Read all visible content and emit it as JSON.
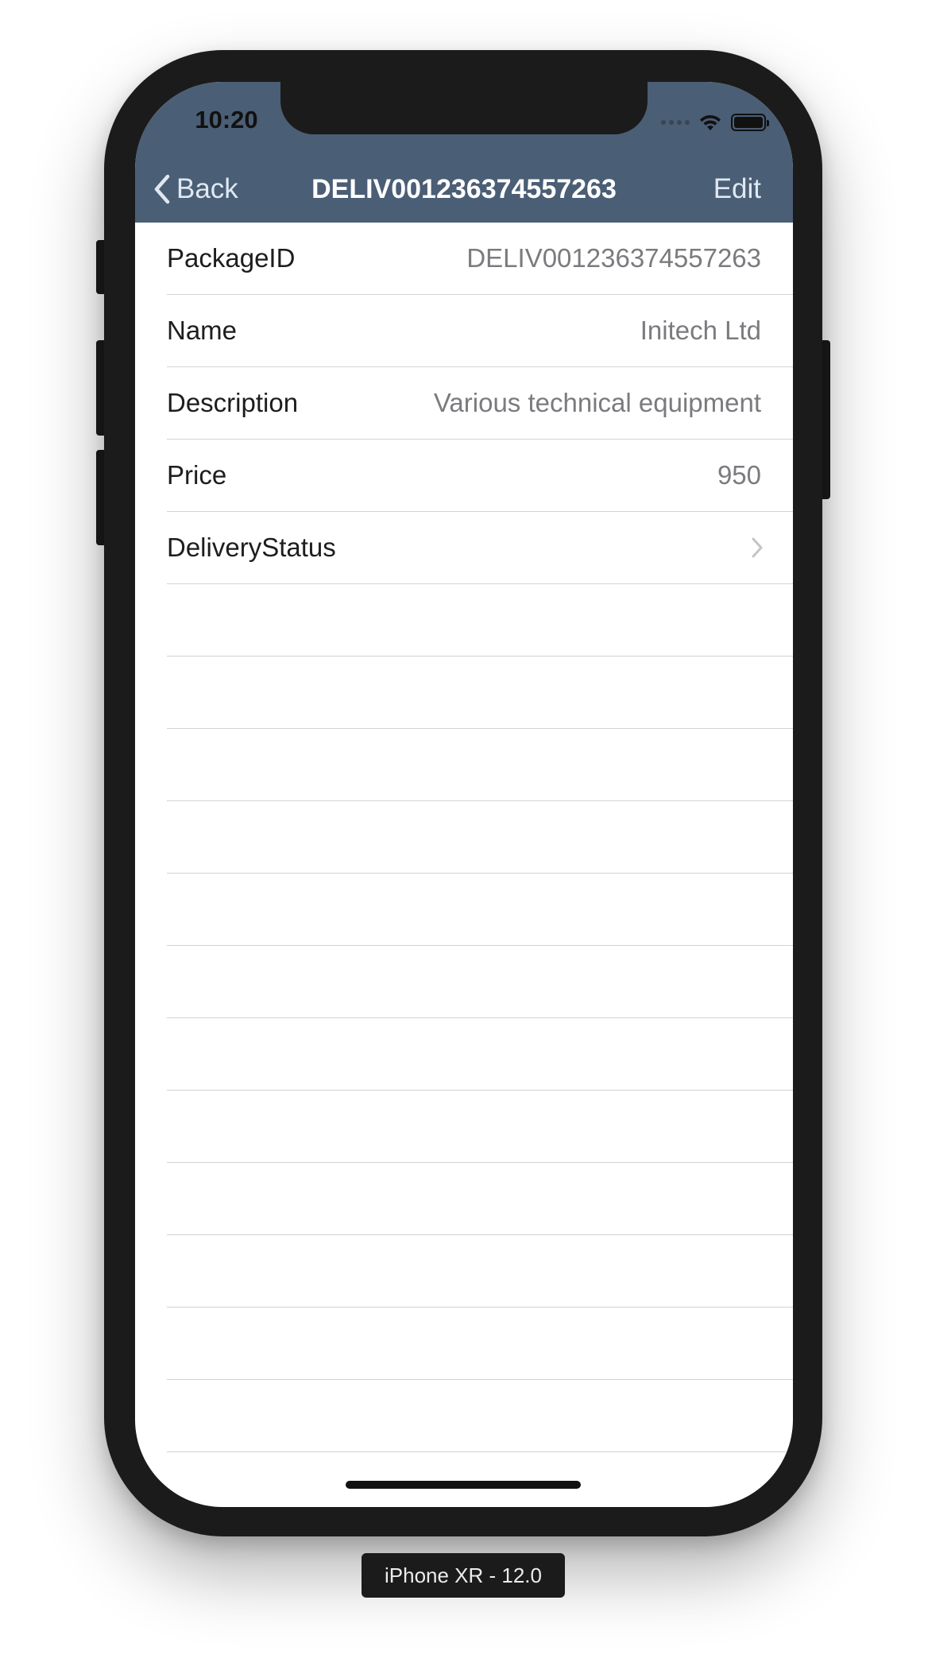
{
  "status_bar": {
    "time": "10:20"
  },
  "nav": {
    "back_label": "Back",
    "title": "DELIV001236374557263",
    "edit_label": "Edit",
    "background_color": "#4a5e75"
  },
  "rows": [
    {
      "label": "PackageID",
      "value": "DELIV001236374557263"
    },
    {
      "label": "Name",
      "value": "Initech Ltd"
    },
    {
      "label": "Description",
      "value": "Various technical equipment"
    },
    {
      "label": "Price",
      "value": "950"
    },
    {
      "label": "DeliveryStatus",
      "value": ""
    }
  ],
  "device_label": "iPhone XR - 12.0",
  "icons": {
    "back": "chevron-left-icon",
    "disclosure": "chevron-right-icon",
    "wifi": "wifi-icon",
    "battery": "battery-icon",
    "signal": "signal-icon"
  }
}
